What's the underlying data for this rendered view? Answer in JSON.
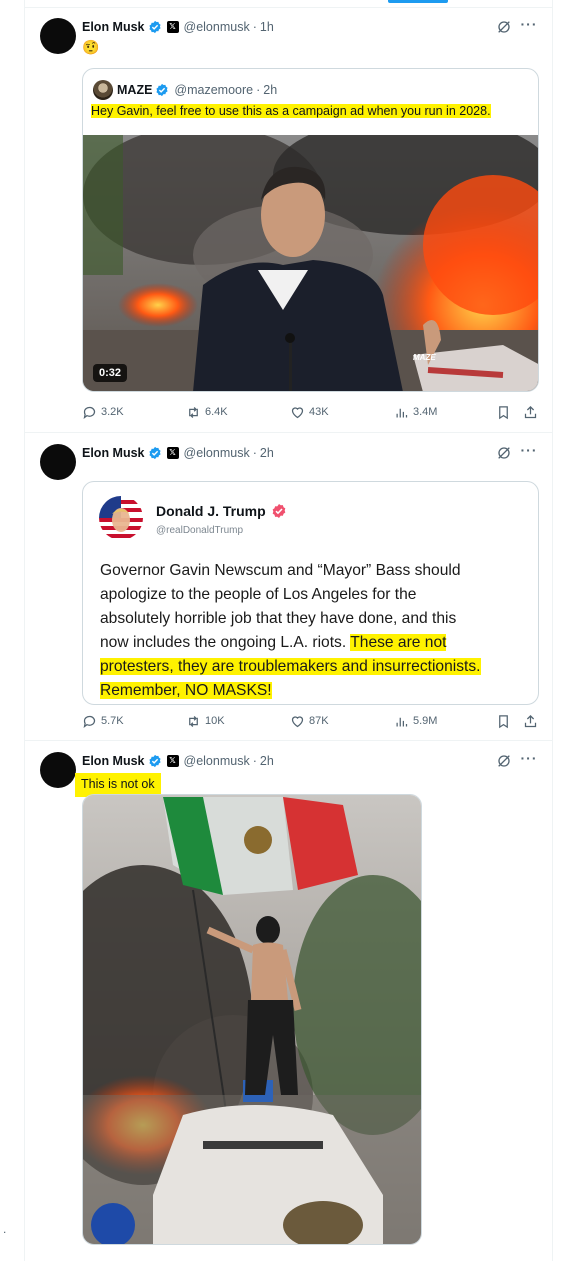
{
  "tweets": [
    {
      "author": "Elon Musk",
      "handle": "@elonmusk",
      "time": "1h",
      "text": "🤨",
      "quote": {
        "author": "MAZE",
        "handle": "@mazemoore",
        "time": "2h",
        "text": "Hey Gavin, feel free to use this as a campaign ad when you run in 2028.",
        "video_duration": "0:32",
        "watermark": "MAZE"
      },
      "stats": {
        "replies": "3.2K",
        "reposts": "6.4K",
        "likes": "43K",
        "views": "3.4M"
      }
    },
    {
      "author": "Elon Musk",
      "handle": "@elonmusk",
      "time": "2h",
      "card": {
        "author": "Donald J. Trump",
        "handle": "@realDonaldTrump",
        "lines": [
          "Governor Gavin Newscum and “Mayor” Bass should",
          "apologize to the people of Los Angeles for the",
          "absolutely horrible job that they have done, and this",
          "now includes the ongoing L.A. riots. ",
          "These are not",
          "protesters, they are troublemakers and insurrectionists.",
          "Remember, NO MASKS!"
        ]
      },
      "stats": {
        "replies": "5.7K",
        "reposts": "10K",
        "likes": "87K",
        "views": "5.9M"
      }
    },
    {
      "author": "Elon Musk",
      "handle": "@elonmusk",
      "time": "2h",
      "text": "This is not ok"
    }
  ],
  "icons": {
    "verified": "verified-badge-icon",
    "affiliate": "x-logo-icon",
    "grok": "grok-icon",
    "more": "more-icon",
    "reply": "reply-icon",
    "repost": "repost-icon",
    "like": "like-icon",
    "views": "views-icon",
    "bookmark": "bookmark-icon",
    "share": "share-icon"
  },
  "colors": {
    "highlight": "#fff200",
    "verified": "#1d9bf0",
    "trump_verified": "#f0506e",
    "muted": "#536471"
  },
  "affiliate_label": "𝕏",
  "more_label": "···",
  "stray_mark": "."
}
